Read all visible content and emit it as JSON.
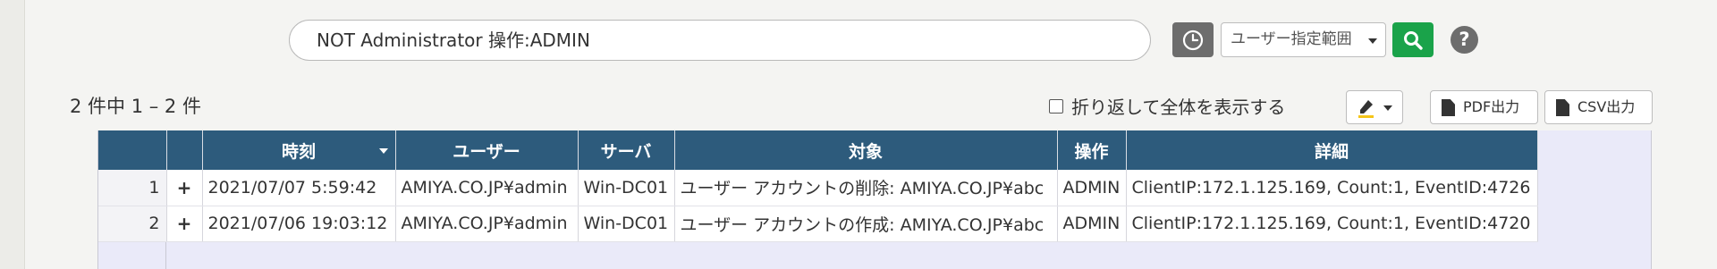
{
  "search": {
    "query": "NOT Administrator 操作:ADMIN",
    "range_label": "ユーザー指定範囲"
  },
  "icons": {
    "clock": "clock-icon",
    "search": "search-icon",
    "help": "question-circle-icon",
    "pen": "highlighter-pen-icon",
    "pdf": "pdf-file-icon",
    "csv": "file-icon"
  },
  "colors": {
    "header_bg": "#2d5b7c",
    "search_button": "#1aa34a",
    "clock_button": "#6d6d6d",
    "highlight_underline": "#f5c518"
  },
  "results": {
    "count_text": "2 件中 1 – 2 件"
  },
  "options": {
    "wrap_label": "折り返して全体を表示する"
  },
  "toolbar": {
    "help_label": "?",
    "pdf_label": "PDF出力",
    "csv_label": "CSV出力"
  },
  "table": {
    "columns": [
      "",
      "",
      "時刻",
      "ユーザー",
      "サーバ",
      "対象",
      "操作",
      "詳細"
    ],
    "rows": [
      {
        "num": "1",
        "expand": "+",
        "time": "2021/07/07 5:59:42",
        "user": "AMIYA.CO.JP¥admin",
        "server": "Win-DC01",
        "target": "ユーザー アカウントの削除: AMIYA.CO.JP¥abc",
        "operation": "ADMIN",
        "detail": "ClientIP:172.1.125.169, Count:1, EventID:4726"
      },
      {
        "num": "2",
        "expand": "+",
        "time": "2021/07/06 19:03:12",
        "user": "AMIYA.CO.JP¥admin",
        "server": "Win-DC01",
        "target": "ユーザー アカウントの作成: AMIYA.CO.JP¥abc",
        "operation": "ADMIN",
        "detail": "ClientIP:172.1.125.169, Count:1, EventID:4720"
      }
    ]
  }
}
